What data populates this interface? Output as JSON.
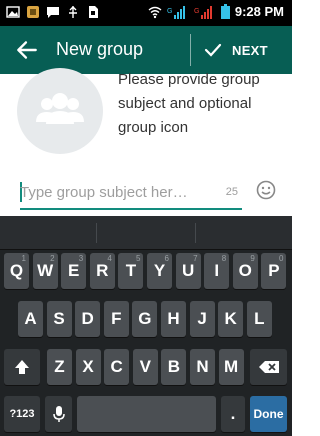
{
  "status_bar": {
    "time": "9:28",
    "ampm": "PM",
    "icons": [
      "image-icon",
      "app-icon",
      "chat-icon",
      "usb-icon",
      "sim-icon",
      "wifi-icon",
      "signal-icon",
      "battery-icon"
    ],
    "network_labels": [
      "G",
      "G"
    ]
  },
  "app_bar": {
    "title": "New group",
    "next_label": "NEXT",
    "color": "#075e54"
  },
  "content": {
    "instructions": "Please provide group subject and optional group icon",
    "subject_placeholder": "Type group subject her…",
    "subject_value": "",
    "char_counter": "25",
    "accent": "#128c7e"
  },
  "keyboard": {
    "row1": [
      {
        "k": "Q",
        "s": "1"
      },
      {
        "k": "W",
        "s": "2"
      },
      {
        "k": "E",
        "s": "3"
      },
      {
        "k": "R",
        "s": "4"
      },
      {
        "k": "T",
        "s": "5"
      },
      {
        "k": "Y",
        "s": "6"
      },
      {
        "k": "U",
        "s": "7"
      },
      {
        "k": "I",
        "s": "8"
      },
      {
        "k": "O",
        "s": "9"
      },
      {
        "k": "P",
        "s": "0"
      }
    ],
    "row2": [
      "A",
      "S",
      "D",
      "F",
      "G",
      "H",
      "J",
      "K",
      "L"
    ],
    "row3": [
      "Z",
      "X",
      "C",
      "V",
      "B",
      "N",
      "M"
    ],
    "symbols_label": "?123",
    "period_label": ".",
    "done_label": "Done"
  }
}
